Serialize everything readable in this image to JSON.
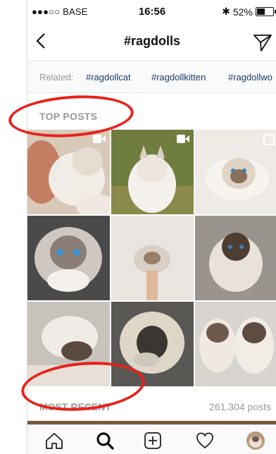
{
  "status_bar": {
    "carrier": "●●●○○ BASE",
    "time": "16:56",
    "battery": "52%",
    "bluetooth": "bluetooth-icon",
    "wifi": "wifi-icon"
  },
  "header": {
    "title": "#ragdolls",
    "back_icon": "chevron-left-icon",
    "share_icon": "paper-plane-icon"
  },
  "related": {
    "label": "Related:",
    "tags": [
      "#ragdollcat",
      "#ragdollkitten",
      "#ragdollwo"
    ]
  },
  "top_posts": {
    "label": "TOP POSTS"
  },
  "most_recent": {
    "label": "MOST RECENT",
    "count": "261.304 posts"
  },
  "tabbar": {
    "items": [
      "home-icon",
      "search-icon",
      "add-icon",
      "heart-icon",
      "profile-avatar"
    ]
  },
  "colors": {
    "accent_red": "#e8221b",
    "link_blue": "#1a3a6b",
    "muted_gray": "#999999"
  }
}
